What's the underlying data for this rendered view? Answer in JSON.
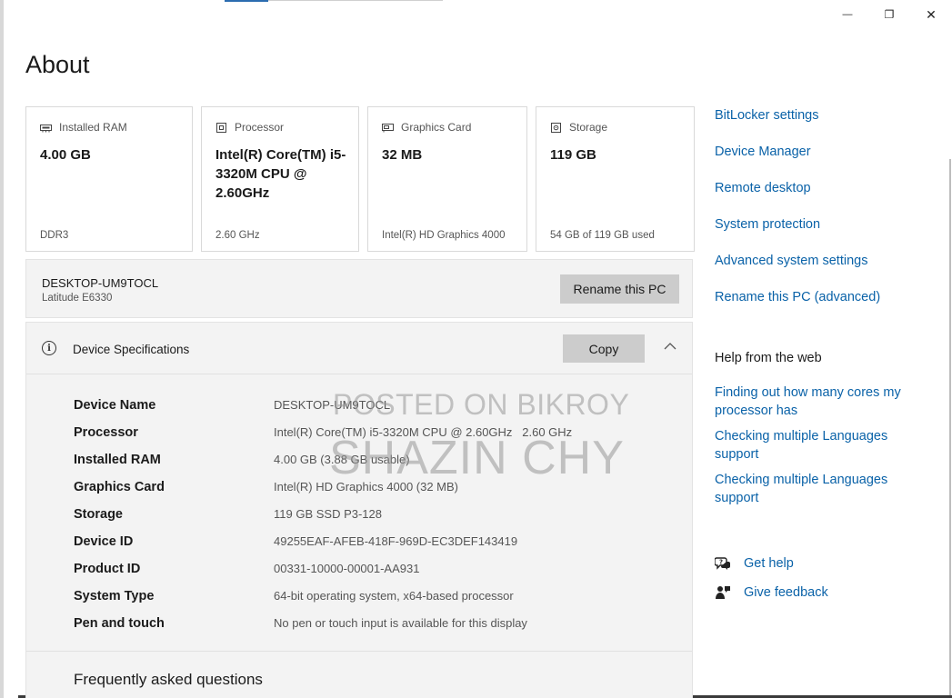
{
  "window": {
    "minimize_glyph": "—",
    "maximize_glyph": "❐",
    "close_glyph": "✕"
  },
  "page": {
    "title": "About"
  },
  "cards": [
    {
      "heading": "Installed RAM",
      "value": "4.00 GB",
      "footer": "DDR3",
      "icon": "memory-icon"
    },
    {
      "heading": "Processor",
      "value": "Intel(R) Core(TM) i5-3320M CPU @ 2.60GHz",
      "footer": "2.60 GHz",
      "icon": "processor-icon"
    },
    {
      "heading": "Graphics Card",
      "value": "32 MB",
      "footer": "Intel(R) HD Graphics 4000",
      "icon": "graphics-card-icon"
    },
    {
      "heading": "Storage",
      "value": "119 GB",
      "footer": "54 GB of 119 GB used",
      "icon": "storage-icon"
    }
  ],
  "pc": {
    "name": "DESKTOP-UM9TOCL",
    "model": "Latitude E6330",
    "rename_label": "Rename this PC"
  },
  "specs": {
    "title": "Device Specifications",
    "copy_label": "Copy",
    "rows": [
      {
        "label": "Device Name",
        "value": "DESKTOP-UM9TOCL"
      },
      {
        "label": "Processor",
        "value": "Intel(R) Core(TM) i5-3320M CPU @ 2.60GHz   2.60 GHz"
      },
      {
        "label": "Installed RAM",
        "value": "4.00 GB (3.88 GB usable)"
      },
      {
        "label": "Graphics Card",
        "value": "Intel(R) HD Graphics 4000 (32 MB)"
      },
      {
        "label": "Storage",
        "value": "119 GB SSD P3-128"
      },
      {
        "label": "Device ID",
        "value": "49255EAF-AFEB-418F-969D-EC3DEF143419"
      },
      {
        "label": "Product ID",
        "value": "00331-10000-00001-AA931"
      },
      {
        "label": "System Type",
        "value": "64-bit operating system, x64-based processor"
      },
      {
        "label": "Pen and touch",
        "value": "No pen or touch input is available for this display"
      }
    ],
    "faq_title": "Frequently asked questions"
  },
  "watermark": {
    "line1": "POSTED ON BIKROY",
    "line2": "SHAZIN CHY"
  },
  "related_settings": [
    "BitLocker settings",
    "Device Manager",
    "Remote desktop",
    "System protection",
    "Advanced system settings",
    "Rename this PC (advanced)"
  ],
  "help": {
    "title": "Help from the web",
    "links": [
      "Finding out how many cores my processor has",
      "Checking multiple Languages support",
      "Checking multiple Languages support"
    ]
  },
  "support": {
    "get_help": "Get help",
    "give_feedback": "Give feedback"
  },
  "colors": {
    "link": "#0a62a8",
    "button": "#cccccc",
    "panel": "#f3f3f3"
  }
}
